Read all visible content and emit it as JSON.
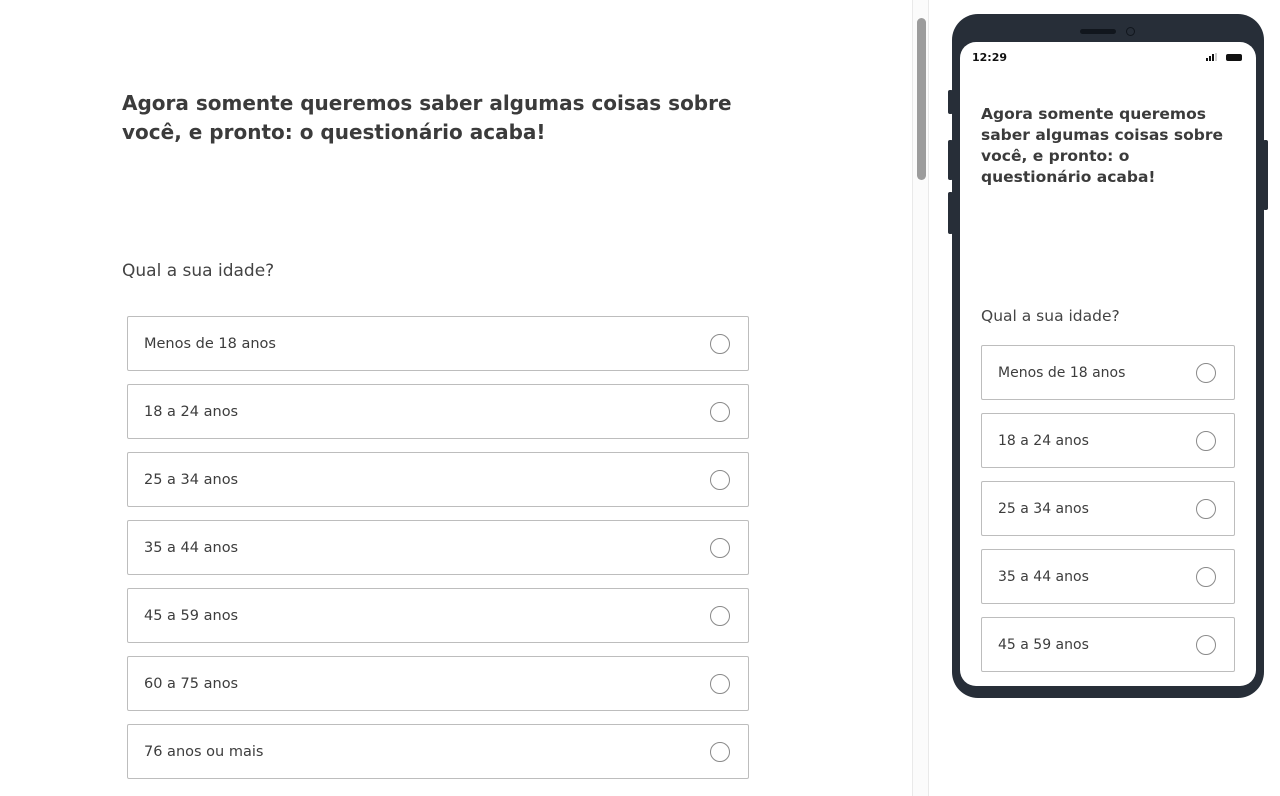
{
  "desktop": {
    "heading": "Agora somente queremos saber algumas coisas sobre você, e pronto: o questionário acaba!",
    "question": "Qual a sua idade?",
    "options": [
      "Menos de 18 anos",
      "18 a 24 anos",
      "25 a 34 anos",
      "35 a 44 anos",
      "45 a 59 anos",
      "60 a 75 anos",
      "76 anos ou mais"
    ]
  },
  "phone": {
    "status_time": "12:29",
    "heading": "Agora somente queremos saber algumas coisas sobre você, e pronto: o questionário acaba!",
    "question": "Qual a sua idade?",
    "options": [
      "Menos de 18 anos",
      "18 a 24 anos",
      "25 a 34 anos",
      "35 a 44 anos",
      "45 a 59 anos"
    ]
  },
  "icons": {
    "radio": "radio-unchecked-icon",
    "signal": "signal-icon",
    "battery": "battery-icon"
  },
  "colors": {
    "phone_frame": "#272e38",
    "option_border": "#bdbdbd",
    "text": "#3b3b3b"
  }
}
